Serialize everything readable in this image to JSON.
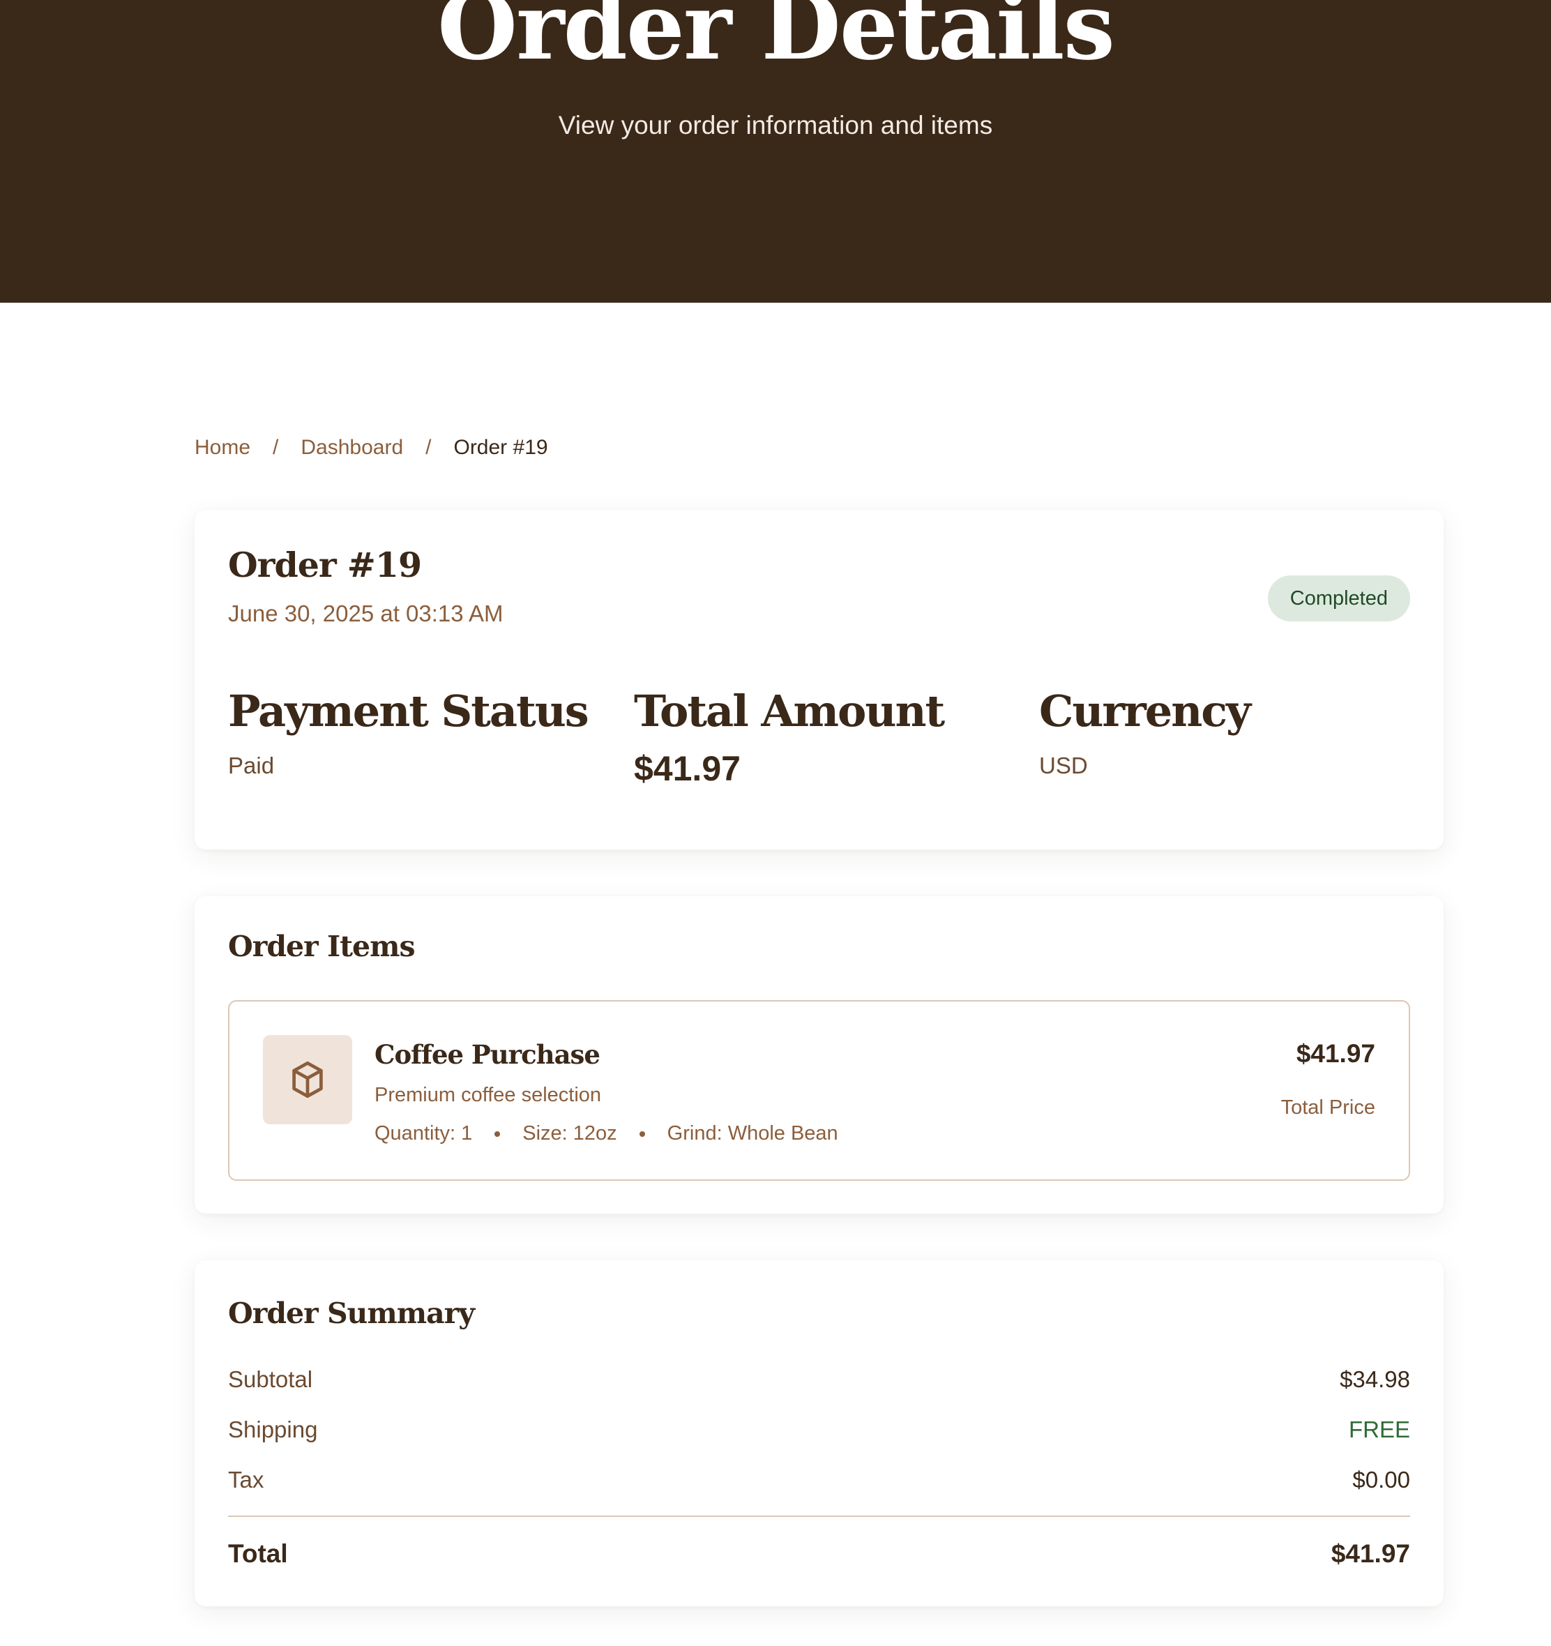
{
  "hero": {
    "title": "Order Details",
    "subtitle": "View your order information and items"
  },
  "breadcrumb": {
    "items": [
      "Home",
      "Dashboard"
    ],
    "current": "Order #19",
    "separator": "/"
  },
  "order": {
    "title": "Order #19",
    "date": "June 30, 2025 at 03:13 AM",
    "status": "Completed",
    "payment_status_label": "Payment Status",
    "payment_status": "Paid",
    "total_amount_label": "Total Amount",
    "total_amount": "$41.97",
    "currency_label": "Currency",
    "currency": "USD"
  },
  "items_section": {
    "title": "Order Items",
    "items": [
      {
        "icon": "box-icon",
        "name": "Coffee Purchase",
        "description": "Premium coffee selection",
        "quantity": "Quantity: 1",
        "size": "Size: 12oz",
        "grind": "Grind: Whole Bean",
        "price": "$41.97",
        "price_label": "Total Price"
      }
    ]
  },
  "summary": {
    "title": "Order Summary",
    "subtotal_label": "Subtotal",
    "subtotal": "$34.98",
    "shipping_label": "Shipping",
    "shipping": "FREE",
    "tax_label": "Tax",
    "tax": "$0.00",
    "total_label": "Total",
    "total": "$41.97"
  },
  "colors": {
    "brand_dark": "#3a2819",
    "accent_brown": "#8b5e3c",
    "badge_bg": "#dde9de",
    "badge_text": "#1f4a28",
    "free_green": "#2e6b36",
    "thumb_bg": "#f0e4da"
  }
}
